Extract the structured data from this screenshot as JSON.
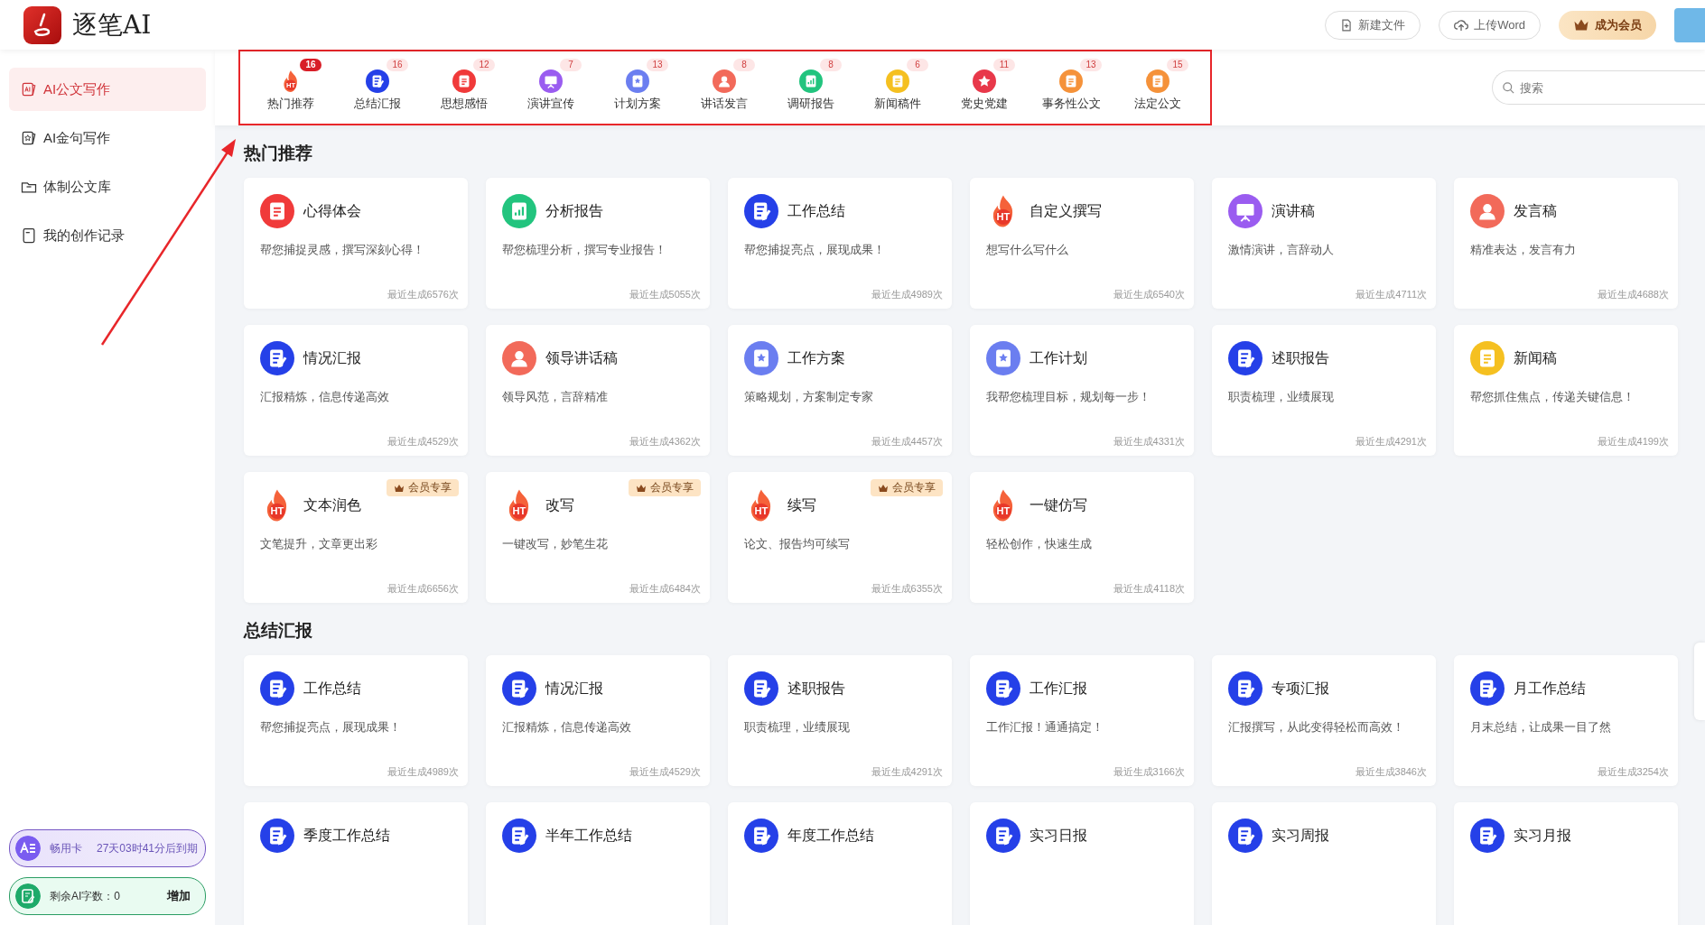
{
  "header": {
    "logo_text": "逐笔AI",
    "buttons": [
      {
        "kind": "new-file",
        "label": "新建文件"
      },
      {
        "kind": "upload",
        "label": "上传Word"
      },
      {
        "kind": "member",
        "label": "成为会员"
      }
    ]
  },
  "sidebar": {
    "items": [
      {
        "kind": "ai-card",
        "label": "AI公文写作",
        "selected": true
      },
      {
        "kind": "star-card",
        "label": "AI金句写作",
        "selected": false
      },
      {
        "kind": "folder",
        "label": "体制公文库",
        "selected": false
      },
      {
        "kind": "book",
        "label": "我的创作记录",
        "selected": false
      }
    ],
    "membership": {
      "name": "畅用卡",
      "expiry": "27天03时41分后到期"
    },
    "quota": {
      "label": "剩余AI字数：0",
      "action": "增加"
    }
  },
  "tabs": [
    {
      "label": "热门推荐",
      "count": "16",
      "kind": "flame",
      "icon_text": "HT",
      "color": "#f5623a",
      "selected": true
    },
    {
      "label": "总结汇报",
      "count": "16",
      "kind": "doc-pen",
      "color": "#2540e8",
      "selected": false
    },
    {
      "label": "思想感悟",
      "count": "12",
      "kind": "list",
      "color": "#f03a3a",
      "selected": false
    },
    {
      "label": "演讲宣传",
      "count": "7",
      "kind": "board",
      "color": "#9a5cf0",
      "selected": false
    },
    {
      "label": "计划方案",
      "count": "13",
      "kind": "doc-star",
      "color": "#6b7ef0",
      "selected": false
    },
    {
      "label": "讲话发言",
      "count": "8",
      "kind": "person",
      "color": "#f26a5a",
      "selected": false
    },
    {
      "label": "调研报告",
      "count": "8",
      "kind": "chart",
      "color": "#22c47e",
      "selected": false
    },
    {
      "label": "新闻稿件",
      "count": "6",
      "kind": "list",
      "color": "#f5c020",
      "selected": false
    },
    {
      "label": "党史党建",
      "count": "11",
      "kind": "star",
      "color": "#e8384a",
      "selected": false
    },
    {
      "label": "事务性公文",
      "count": "13",
      "kind": "list",
      "color": "#f5923a",
      "selected": false
    },
    {
      "label": "法定公文",
      "count": "15",
      "kind": "list",
      "color": "#f5923a",
      "selected": false
    }
  ],
  "search": {
    "placeholder": "搜索"
  },
  "sections": [
    {
      "title": "热门推荐",
      "cards": [
        {
          "title": "心得体会",
          "desc": "帮您捕捉灵感，撰写深刻心得！",
          "usage": "最近生成6576次",
          "kind": "list",
          "color": "#f03a3a"
        },
        {
          "title": "分析报告",
          "desc": "帮您梳理分析，撰写专业报告！",
          "usage": "最近生成5055次",
          "kind": "chart",
          "color": "#22c47e"
        },
        {
          "title": "工作总结",
          "desc": "帮您捕捉亮点，展现成果！",
          "usage": "最近生成4989次",
          "kind": "doc-pen",
          "color": "#2540e8"
        },
        {
          "title": "自定义撰写",
          "desc": "想写什么写什么",
          "usage": "最近生成6540次",
          "kind": "flame",
          "icon_text": "HT",
          "color": "#f5623a"
        },
        {
          "title": "演讲稿",
          "desc": "激情演讲，言辞动人",
          "usage": "最近生成4711次",
          "kind": "board",
          "color": "#9a5cf0"
        },
        {
          "title": "发言稿",
          "desc": "精准表达，发言有力",
          "usage": "最近生成4688次",
          "kind": "person",
          "color": "#f26a5a"
        },
        {
          "title": "情况汇报",
          "desc": "汇报精炼，信息传递高效",
          "usage": "最近生成4529次",
          "kind": "doc-pen",
          "color": "#2540e8"
        },
        {
          "title": "领导讲话稿",
          "desc": "领导风范，言辞精准",
          "usage": "最近生成4362次",
          "kind": "person",
          "color": "#f26a5a"
        },
        {
          "title": "工作方案",
          "desc": "策略规划，方案制定专家",
          "usage": "最近生成4457次",
          "kind": "doc-star",
          "color": "#6b7ef0"
        },
        {
          "title": "工作计划",
          "desc": "我帮您梳理目标，规划每一步！",
          "usage": "最近生成4331次",
          "kind": "doc-star",
          "color": "#6b7ef0"
        },
        {
          "title": "述职报告",
          "desc": "职责梳理，业绩展现",
          "usage": "最近生成4291次",
          "kind": "doc-pen",
          "color": "#2540e8"
        },
        {
          "title": "新闻稿",
          "desc": "帮您抓住焦点，传递关键信息！",
          "usage": "最近生成4199次",
          "kind": "list",
          "color": "#f5c020"
        },
        {
          "title": "文本润色",
          "desc": "文笔提升，文章更出彩",
          "usage": "最近生成6656次",
          "kind": "flame",
          "icon_text": "HT",
          "color": "#f5623a",
          "badge": "会员专享"
        },
        {
          "title": "改写",
          "desc": "一键改写，妙笔生花",
          "usage": "最近生成6484次",
          "kind": "flame",
          "icon_text": "HT",
          "color": "#f5623a",
          "badge": "会员专享"
        },
        {
          "title": "续写",
          "desc": "论文、报告均可续写",
          "usage": "最近生成6355次",
          "kind": "flame",
          "icon_text": "HT",
          "color": "#f5623a",
          "badge": "会员专享"
        },
        {
          "title": "一键仿写",
          "desc": "轻松创作，快速生成",
          "usage": "最近生成4118次",
          "kind": "flame",
          "icon_text": "HT",
          "color": "#f5623a"
        }
      ]
    },
    {
      "title": "总结汇报",
      "cards": [
        {
          "title": "工作总结",
          "desc": "帮您捕捉亮点，展现成果！",
          "usage": "最近生成4989次",
          "kind": "doc-pen",
          "color": "#2540e8"
        },
        {
          "title": "情况汇报",
          "desc": "汇报精炼，信息传递高效",
          "usage": "最近生成4529次",
          "kind": "doc-pen",
          "color": "#2540e8"
        },
        {
          "title": "述职报告",
          "desc": "职责梳理，业绩展现",
          "usage": "最近生成4291次",
          "kind": "doc-pen",
          "color": "#2540e8"
        },
        {
          "title": "工作汇报",
          "desc": "工作汇报！通通搞定！",
          "usage": "最近生成3166次",
          "kind": "doc-pen",
          "color": "#2540e8"
        },
        {
          "title": "专项汇报",
          "desc": "汇报撰写，从此变得轻松而高效！",
          "usage": "最近生成3846次",
          "kind": "doc-pen",
          "color": "#2540e8"
        },
        {
          "title": "月工作总结",
          "desc": "月末总结，让成果一目了然",
          "usage": "最近生成3254次",
          "kind": "doc-pen",
          "color": "#2540e8"
        },
        {
          "title": "季度工作总结",
          "kind": "doc-pen",
          "color": "#2540e8"
        },
        {
          "title": "半年工作总结",
          "kind": "doc-pen",
          "color": "#2540e8"
        },
        {
          "title": "年度工作总结",
          "kind": "doc-pen",
          "color": "#2540e8"
        },
        {
          "title": "实习日报",
          "kind": "doc-pen",
          "color": "#2540e8"
        },
        {
          "title": "实习周报",
          "kind": "doc-pen",
          "color": "#2540e8"
        },
        {
          "title": "实习月报",
          "kind": "doc-pen",
          "color": "#2540e8"
        }
      ]
    }
  ]
}
